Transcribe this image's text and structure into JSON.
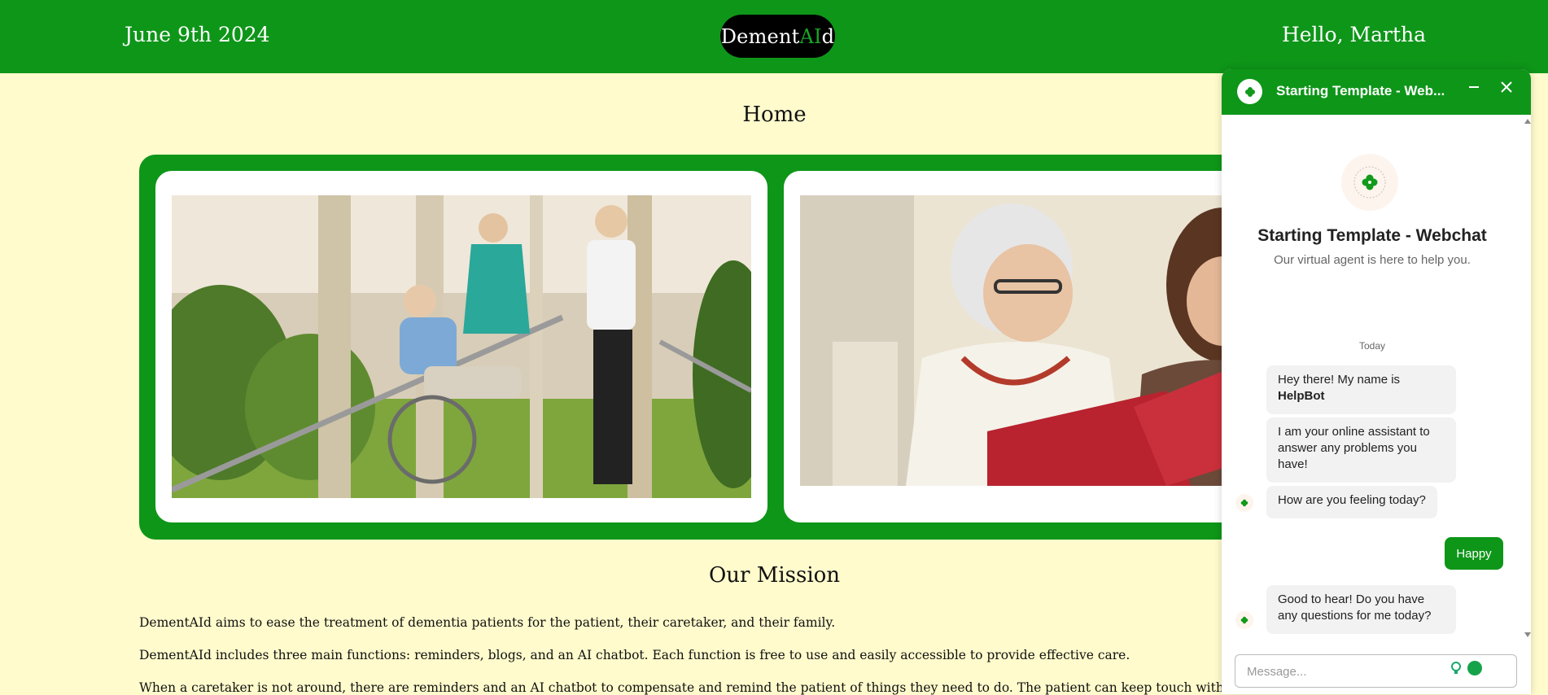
{
  "header": {
    "date": "June 9th 2024",
    "logo_prefix": "Dement",
    "logo_ai": "AI",
    "logo_suffix": "d",
    "greeting": "Hello, Martha"
  },
  "page": {
    "title": "Home",
    "mission_title": "Our Mission",
    "paragraphs": [
      "DementAId aims to ease the treatment of dementia patients for the patient, their caretaker, and their family.",
      "DementAId includes three main functions: reminders, blogs, and an AI chatbot. Each function is free to use and easily accessible to provide effective care.",
      "When a caretaker is not around, there are reminders and an AI chatbot to compensate and remind the patient of things they need to do. The patient can keep touch with their memories thro"
    ]
  },
  "colors": {
    "brand_green": "#0e9619",
    "page_background": "#fffbcc",
    "logo_background": "#000000"
  },
  "chat": {
    "header_title": "Starting Template - Web...",
    "bot_title": "Starting Template - Webchat",
    "bot_subtitle": "Our virtual agent is here to help you.",
    "day_label": "Today",
    "messages": [
      {
        "from": "bot",
        "text_prefix": "Hey there! My name is ",
        "text_bold": "HelpBot"
      },
      {
        "from": "bot",
        "text": "I am your online assistant to answer any problems you have!"
      },
      {
        "from": "bot",
        "text": "How are you feeling today?"
      },
      {
        "from": "user",
        "text": "Happy"
      },
      {
        "from": "bot",
        "text": "Good to hear! Do you have any questions for me today?"
      }
    ],
    "input_placeholder": "Message...",
    "icons": [
      "clover-icon",
      "minimize-icon",
      "close-icon",
      "scroll-up-icon",
      "scroll-down-icon"
    ]
  }
}
